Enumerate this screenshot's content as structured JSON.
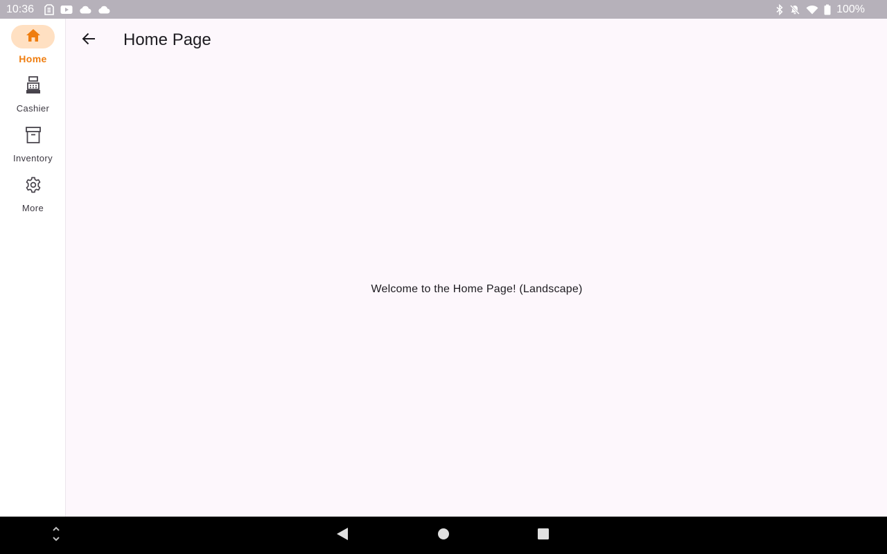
{
  "status_bar": {
    "time": "10:36",
    "left_icons": [
      "sim-icon",
      "youtube-icon",
      "cloud-icon",
      "cloud-icon"
    ],
    "right_icons": [
      "bluetooth-icon",
      "mute-notifications-icon",
      "wifi-icon",
      "battery-icon"
    ],
    "battery": "100%"
  },
  "nav_rail": {
    "items": [
      {
        "label": "Home",
        "icon": "home-icon",
        "active": true
      },
      {
        "label": "Cashier",
        "icon": "cash-register-icon",
        "active": false
      },
      {
        "label": "Inventory",
        "icon": "archive-box-icon",
        "active": false
      },
      {
        "label": "More",
        "icon": "gear-icon",
        "active": false
      }
    ]
  },
  "app_bar": {
    "back_icon": "arrow-back-icon",
    "title": "Home Page"
  },
  "main": {
    "welcome": "Welcome to the Home Page! (Landscape)"
  },
  "system_nav": {
    "buttons": [
      "rotate-icon",
      "back-triangle-icon",
      "home-circle-icon",
      "recents-square-icon"
    ]
  },
  "colors": {
    "accent": "#ef7d0f",
    "accent_container": "#ffe0c2",
    "background": "#fdf7fc",
    "status_bar": "#b6b1ba"
  }
}
